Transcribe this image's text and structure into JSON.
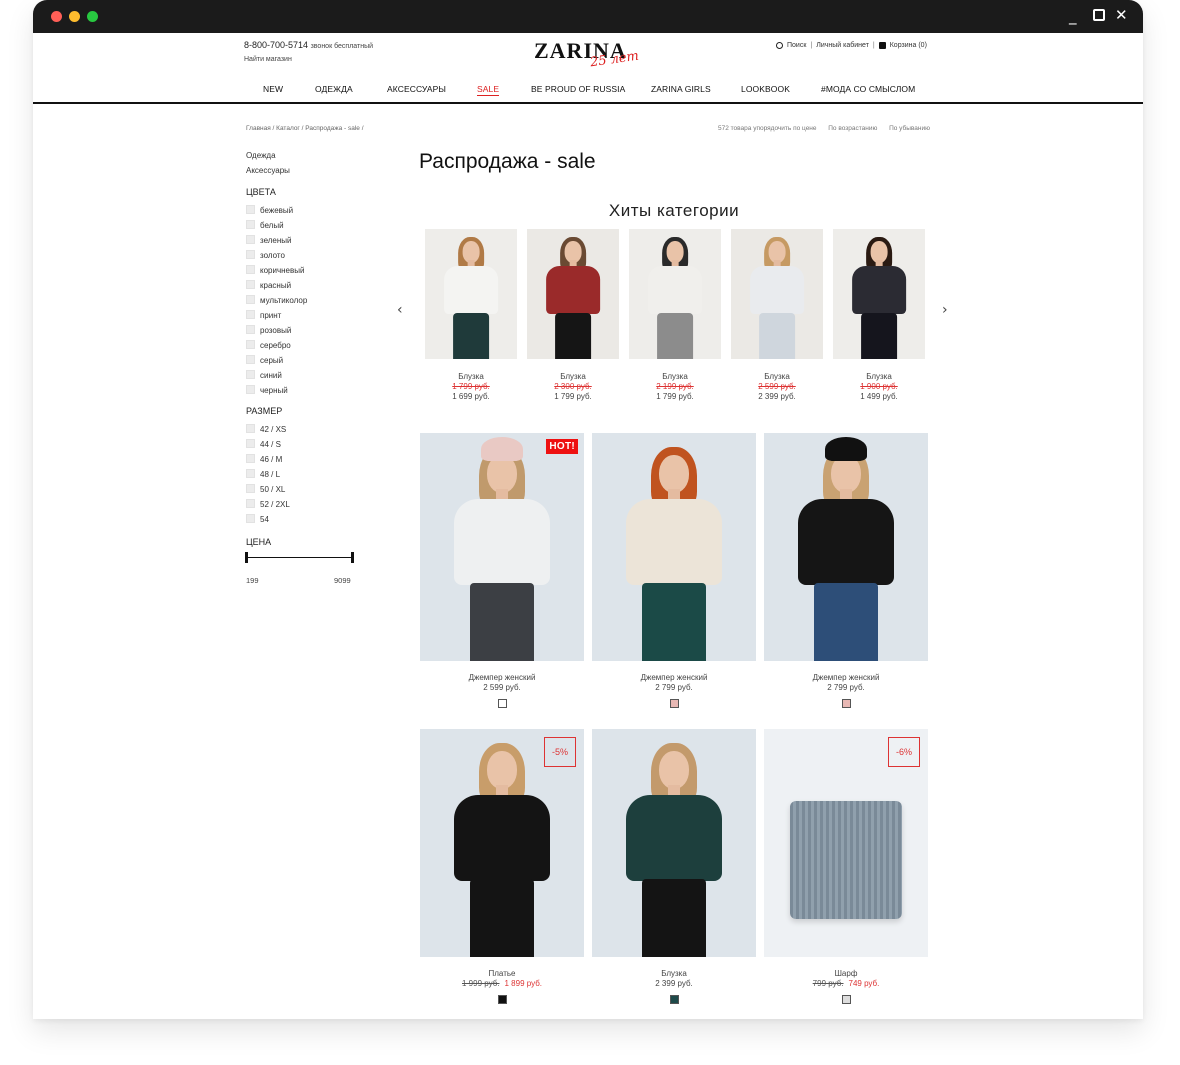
{
  "header": {
    "phone": "8-800-700-5714",
    "phone_note": "звонок бесплатный",
    "find_store": "Найти магазин",
    "logo": "ZARINA",
    "logo_anniv": "25 лет",
    "search": "Поиск",
    "account": "Личный кабинет",
    "cart": "Корзина (0)"
  },
  "nav": [
    {
      "label": "NEW"
    },
    {
      "label": "ОДЕЖДА"
    },
    {
      "label": "АКСЕССУАРЫ"
    },
    {
      "label": "SALE"
    },
    {
      "label": "BE PROUD OF RUSSIA"
    },
    {
      "label": "ZARINA GIRLS"
    },
    {
      "label": "LOOKBOOK"
    },
    {
      "label": "#МОДА СО СМЫСЛОМ"
    }
  ],
  "breadcrumb": [
    "Главная",
    "Каталог",
    "Распродажа - sale"
  ],
  "sort": {
    "count": "572 товара упорядочить по цене",
    "asc": "По возрастанию",
    "desc": "По убыванию"
  },
  "page_title": "Распродажа - sale",
  "sidebar": {
    "categories": [
      "Одежда",
      "Аксессуары"
    ],
    "colors_title": "ЦВЕТА",
    "colors": [
      "бежевый",
      "белый",
      "зеленый",
      "золото",
      "коричневый",
      "красный",
      "мультиколор",
      "принт",
      "розовый",
      "серебро",
      "серый",
      "синий",
      "черный"
    ],
    "size_title": "РАЗМЕР",
    "sizes": [
      "42 / XS",
      "44 / S",
      "46 / M",
      "48 / L",
      "50 / XL",
      "52 / 2XL",
      "54"
    ],
    "price_title": "ЦЕНА",
    "price_min": "199",
    "price_max": "9099"
  },
  "hits": {
    "title": "Хиты категории",
    "prev_icon": "chevron-left-icon",
    "next_icon": "chevron-right-icon",
    "items": [
      {
        "name": "Блузка",
        "old_price": "1 799 руб.",
        "price": "1 699 руб.",
        "top": "#f4f4f2",
        "bottom": "#1f3a3a",
        "hair": "#b07a46"
      },
      {
        "name": "Блузка",
        "old_price": "2 300 руб.",
        "price": "1 799 руб.",
        "top": "#9a2a2a",
        "bottom": "#151515",
        "hair": "#6a4a33"
      },
      {
        "name": "Блузка",
        "old_price": "2 199 руб.",
        "price": "1 799 руб.",
        "top": "#f0efec",
        "bottom": "#8c8c8c",
        "hair": "#2a2a2a"
      },
      {
        "name": "Блузка",
        "old_price": "2 599 руб.",
        "price": "2 399 руб.",
        "top": "#e9ebee",
        "bottom": "#cfd6dd",
        "hair": "#c69a63"
      },
      {
        "name": "Блузка",
        "old_price": "1 900 руб.",
        "price": "1 499 руб.",
        "top": "#2b2b33",
        "bottom": "#15151d",
        "hair": "#2a1a12"
      }
    ]
  },
  "products": [
    {
      "name": "Джемпер женский",
      "price": "2 599 руб.",
      "old_price": "",
      "badge": "HOT!",
      "badge_type": "hot",
      "swatch": "#ffffff",
      "top": "#eef0f1",
      "bottom": "#3c3f44",
      "hair": "#c09a6c",
      "hat": "#e9c9c4"
    },
    {
      "name": "Джемпер женский",
      "price": "2 799 руб.",
      "old_price": "",
      "badge": "",
      "badge_type": "",
      "swatch": "#e8b8b4",
      "top": "#ece4d8",
      "bottom": "#1b4a47",
      "hair": "#c0531f",
      "hat": ""
    },
    {
      "name": "Джемпер женский",
      "price": "2 799 руб.",
      "old_price": "",
      "badge": "",
      "badge_type": "",
      "swatch": "#e8b8b4",
      "top": "#151515",
      "bottom": "#2d4e78",
      "hair": "#c9a272",
      "hat": "#111111"
    },
    {
      "name": "Платье",
      "price": "1 899 руб.",
      "old_price": "1 999 руб.",
      "badge": "-5%",
      "badge_type": "disc",
      "swatch": "#111111",
      "top": "#141414",
      "bottom": "#141414",
      "hair": "#c89d6a",
      "hat": ""
    },
    {
      "name": "Блузка",
      "price": "2 399 руб.",
      "old_price": "",
      "badge": "",
      "badge_type": "",
      "swatch": "#1e4a4a",
      "top": "#1d3f3d",
      "bottom": "#141414",
      "hair": "#c39a6c",
      "hat": ""
    },
    {
      "name": "Шарф",
      "price": "749 руб.",
      "old_price": "799 руб.",
      "badge": "-6%",
      "badge_type": "disc",
      "swatch": "#dddddd",
      "top": "",
      "bottom": "",
      "hair": "",
      "hat": ""
    }
  ]
}
